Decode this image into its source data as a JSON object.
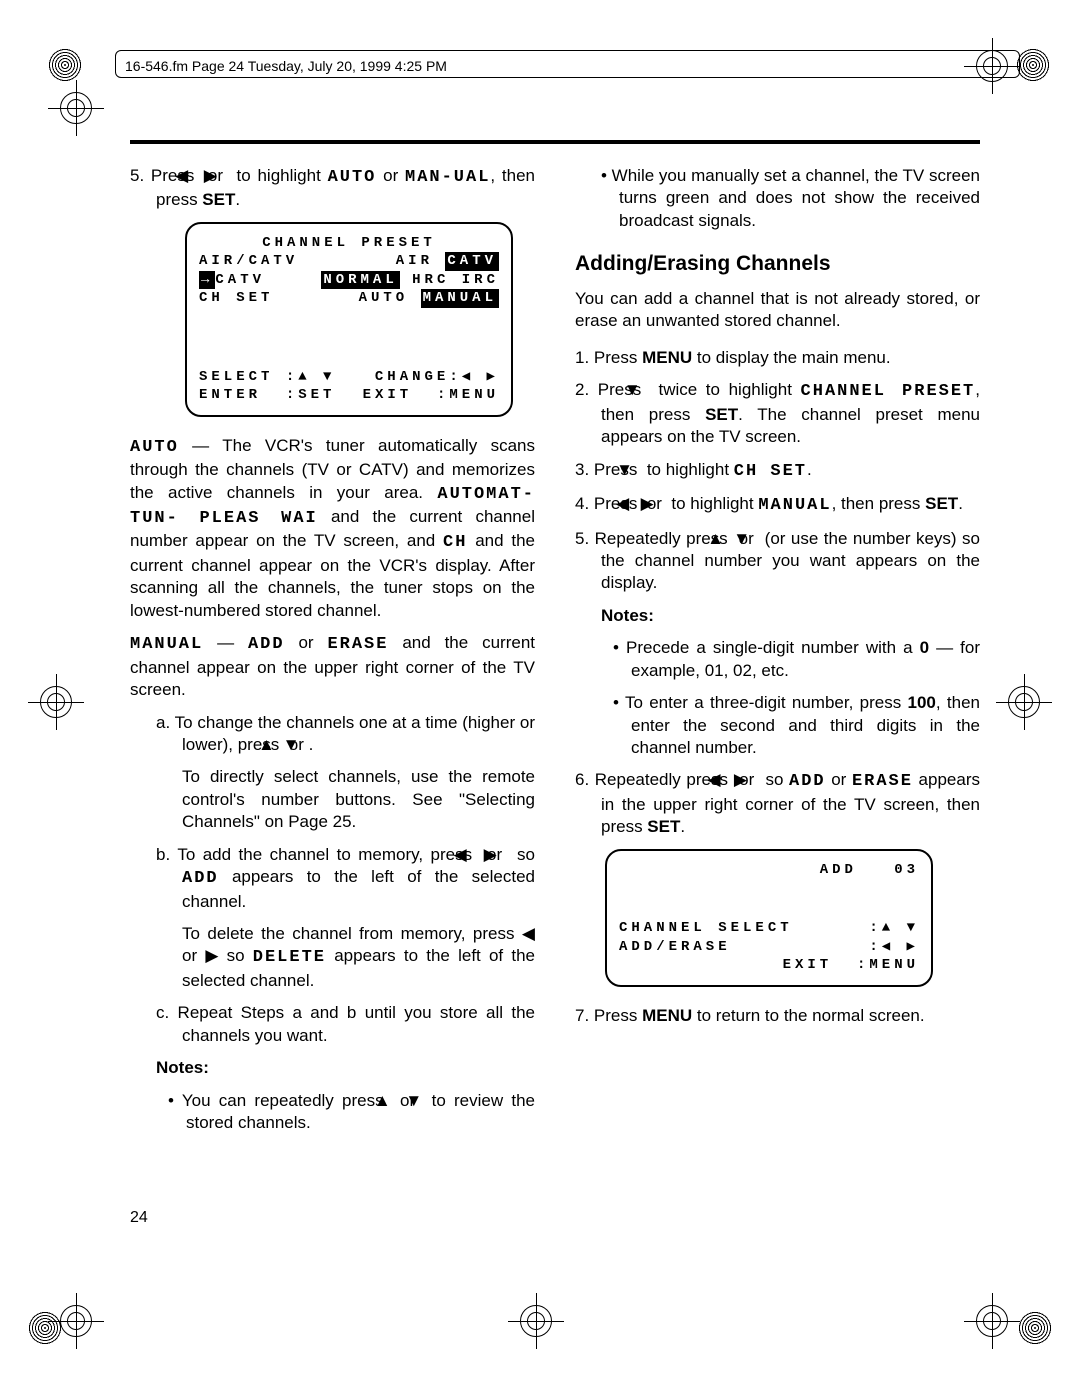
{
  "header": "16-546.fm  Page 24  Tuesday, July 20, 1999  4:25 PM",
  "page_number": "24",
  "left": {
    "step5_a": "5.  Press ",
    "step5_b": " or ",
    "step5_c": " to highlight ",
    "step5_auto": "AUTO",
    "step5_d": " or ",
    "step5_man": "MAN-UAL",
    "step5_e": ", then press ",
    "step5_set": "SET",
    "step5_f": ".",
    "screen1": {
      "title": "CHANNEL PRESET",
      "r1_l": "AIR/CATV",
      "r1_r1": "AIR",
      "r1_r2": "CATV",
      "r2_l": "CATV",
      "r2_c": "NORMAL",
      "r2_r1": "HRC",
      "r2_r2": "IRC",
      "r3_l": "CH SET",
      "r3_r1": "AUTO",
      "r3_r2": "MANUAL",
      "foot_sel": "SELECT",
      "foot_chg": "CHANGE",
      "foot_ent": "ENTER",
      "foot_set": ":SET",
      "foot_exit": "EXIT",
      "foot_menu": ":MENU"
    },
    "auto_l": "AUTO",
    "auto_body1": " — The VCR's tuner automatically scans through the channels (TV or CATV) and memorizes the active channels in your area. ",
    "auto_code": "AUTOMAT- TUN-   PLEAS WAI",
    "auto_body2": " and the current channel number appear on the TV screen, and ",
    "auto_ch": "CH",
    "auto_body3": " and the current channel appear on the VCR's display. After scanning all the channels, the tuner stops on the lowest-numbered stored channel.",
    "man_l": "MANUAL",
    "man_mid": " — ",
    "man_add": "ADD",
    "man_or": " or ",
    "man_erase": "ERASE",
    "man_body": " and the current channel appear on the upper right corner of the TV screen.",
    "a_txt1": "a.  To change the channels one at a time (higher or lower), press ",
    "a_txt2": " or ",
    "a_txt3": ".",
    "a_para": "To directly select channels, use the remote control's number buttons. See \"Selecting Channels\" on Page 25.",
    "b_txt1": "b.  To add the channel to memory, press ",
    "b_txt2": " or ",
    "b_txt3": " so ",
    "b_add": "ADD",
    "b_txt4": " appears to the left of the selected channel.",
    "b_para1": "To delete the channel from memory, press ",
    "b_para2": " or ",
    "b_para3": " so ",
    "b_del": "DELETE",
    "b_para4": "  appears to the left of the selected channel.",
    "c_txt": "c.  Repeat Steps a and b until you store all the channels you want.",
    "notes_h": "Notes:",
    "note1a": "•  You can repeatedly press ",
    "note1b": " or ",
    "note1c": " to review the stored channels.",
    "note2": "•  While you manually set a channel, the TV screen turns green and does not show the received broadcast signals."
  },
  "right": {
    "heading": "Adding/Erasing Channels",
    "intro": "You can add a channel that is not already stored, or erase an unwanted stored channel.",
    "s1a": "1.  Press ",
    "s1b": "MENU",
    "s1c": " to display the main menu.",
    "s2a": "2.  Press ",
    "s2b": " twice to highlight ",
    "s2c": "CHANNEL PRESET",
    "s2d": ", then press ",
    "s2e": "SET",
    "s2f": ". The channel preset menu appears on the TV screen.",
    "s3a": "3.  Press ",
    "s3b": " to highlight ",
    "s3c": "CH SET",
    "s3d": ".",
    "s4a": "4.  Press ",
    "s4b": " or ",
    "s4c": " to highlight ",
    "s4d": "MANUAL",
    "s4e": ", then press ",
    "s4f": "SET",
    "s4g": ".",
    "s5a": "5.  Repeatedly press ",
    "s5b": " or ",
    "s5c": " (or use the number keys) so the channel number you want appears on the display.",
    "notes_h": "Notes:",
    "rn1a": "•  Precede a single-digit number with a ",
    "rn1b": "0",
    "rn1c": " — for example, 01, 02, etc.",
    "rn2a": "•  To enter a three-digit number, press ",
    "rn2b": "100",
    "rn2c": ", then enter the second and third digits in the channel number.",
    "s6a": "6.  Repeatedly press ",
    "s6b": " or ",
    "s6c": " so ",
    "s6d": "ADD",
    "s6e": " or ",
    "s6f": "ERASE",
    "s6g": " appears in the upper right corner of the TV screen, then press ",
    "s6h": "SET",
    "s6i": ".",
    "screen2": {
      "add": "ADD",
      "num": "03",
      "r1": "CHANNEL SELECT",
      "r2": "ADD/ERASE",
      "exit": "EXIT",
      "menu": ":MENU"
    },
    "s7a": "7.  Press ",
    "s7b": "MENU",
    "s7c": " to return to the normal screen."
  }
}
